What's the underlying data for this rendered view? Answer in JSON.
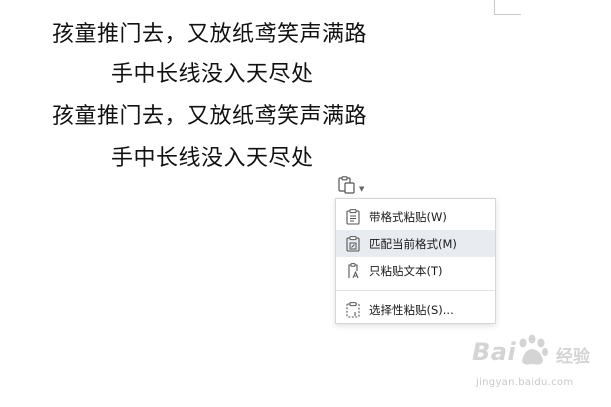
{
  "document": {
    "lines": [
      "孩童推门去，又放纸鸢笑声满路",
      "手中长线没入天尽处",
      "孩童推门去，又放纸鸢笑声满路",
      "手中长线没入天尽处"
    ]
  },
  "paste_options": {
    "trigger_icon": "clipboard-paste-icon",
    "items": [
      {
        "label": "带格式粘贴(W)",
        "icon": "paste-keep-format-icon"
      },
      {
        "label": "匹配当前格式(M)",
        "icon": "paste-match-format-icon",
        "highlighted": true
      },
      {
        "label": "只粘贴文本(T)",
        "icon": "paste-text-only-icon"
      },
      {
        "label": "选择性粘贴(S)...",
        "icon": "paste-special-icon"
      }
    ]
  },
  "watermark": {
    "brand": "Bai",
    "brand_suffix": "经验",
    "url": "jingyan.baidu.com"
  },
  "colors": {
    "menu_hover": "#e8ebef",
    "menu_border": "#d6d6d6",
    "icon_stroke": "#555555",
    "watermark": "#d4d4d4"
  }
}
